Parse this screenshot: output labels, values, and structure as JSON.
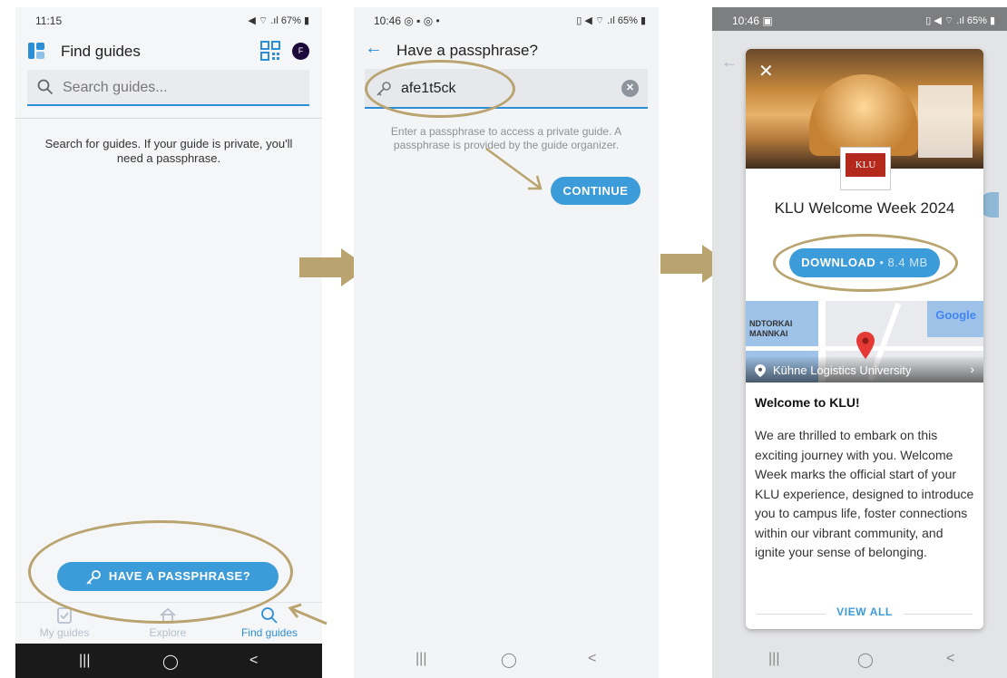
{
  "screen1": {
    "status": {
      "time": "11:15",
      "right": "◀ ⌔ .ıl 67% ▮"
    },
    "title": "Find guides",
    "avatar_letter": "F",
    "search_placeholder": "Search guides...",
    "hint": "Search for guides. If your guide is private, you'll need a passphrase.",
    "passphrase_button": "HAVE A PASSPHRASE?",
    "tabs": [
      {
        "label": "My guides"
      },
      {
        "label": "Explore"
      },
      {
        "label": "Find guides"
      }
    ]
  },
  "screen2": {
    "status": {
      "time": "10:46 ◎ ▪ ◎ •",
      "right": "▯ ◀ ⌔ .ıl 65% ▮"
    },
    "title": "Have a passphrase?",
    "passphrase_value": "afe1t5ck",
    "hint": "Enter a passphrase to access a private guide. A passphrase is provided by the guide organizer.",
    "continue_button": "CONTINUE"
  },
  "screen3": {
    "status": {
      "time": "10:46 ▣",
      "right": "▯ ◀ ⌔ .ıl 65% ▮"
    },
    "logo_text": "KLU",
    "event_title": "KLU Welcome Week 2024",
    "download_label": "DOWNLOAD",
    "download_size": " • 8.4 MB",
    "map": {
      "label1": "NDTORKAI",
      "label2": "MANNKAI",
      "brand": "Google",
      "location": "Kühne Logistics University"
    },
    "welcome_heading": "Welcome to KLU!",
    "body": "We are thrilled to embark on this exciting journey with you. Welcome Week marks the official start of your KLU experience, designed to introduce you to campus life, foster connections within our vibrant community, and ignite your sense of belonging.",
    "view_all": "VIEW ALL"
  },
  "colors": {
    "accent": "#3c9bd9",
    "annotation": "#b9a36e",
    "link": "#2c8ed6"
  }
}
